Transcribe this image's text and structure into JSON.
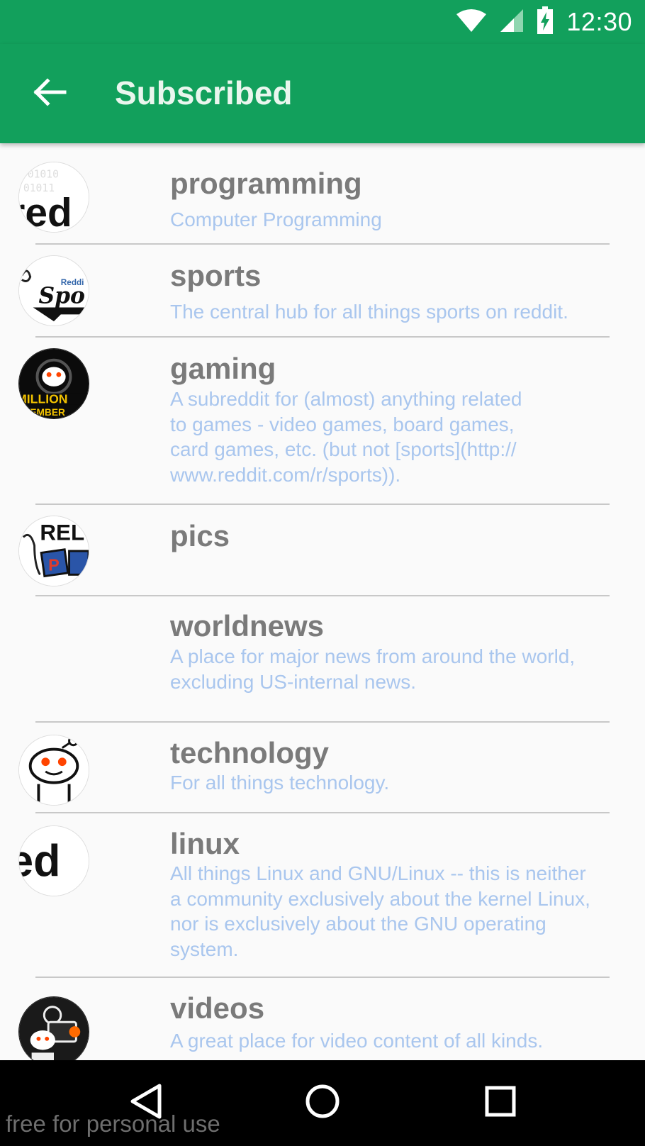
{
  "status_bar": {
    "time": "12:30"
  },
  "toolbar": {
    "title": "Subscribed"
  },
  "subreddits": [
    {
      "name": "programming",
      "description": "Computer Programming"
    },
    {
      "name": "sports",
      "description": "The central hub for all things sports on reddit."
    },
    {
      "name": "gaming",
      "description": "A subreddit for (almost) anything related\nto games - video games, board games,\ncard games, etc. (but not [sports](http://\nwww.reddit.com/r/sports))."
    },
    {
      "name": "pics",
      "description": ""
    },
    {
      "name": "worldnews",
      "description": "A place for major news from around the world,\nexcluding US-internal news."
    },
    {
      "name": "technology",
      "description": "For all things technology."
    },
    {
      "name": "linux",
      "description": "All things Linux and GNU/Linux -- this is neither\na community exclusively about the kernel Linux,\nnor is exclusively about the GNU operating\nsystem."
    },
    {
      "name": "videos",
      "description": "A great place for video content of all kinds."
    }
  ],
  "watermark": "free for personal use",
  "colors": {
    "primary": "#12a05c",
    "name_text": "#7a7a7a",
    "description_text": "#a9c6ee",
    "divider": "#c8c8c8"
  }
}
